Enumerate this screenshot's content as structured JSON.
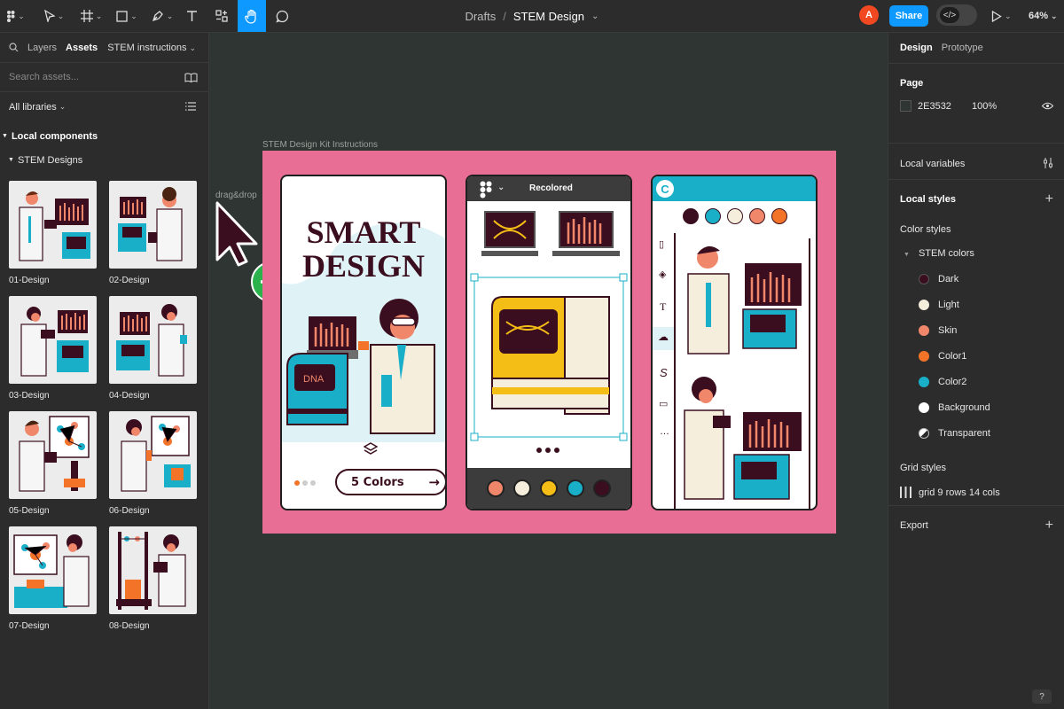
{
  "toolbar": {
    "breadcrumb_parent": "Drafts",
    "breadcrumb_sep": "/",
    "file_name": "STEM Design",
    "avatar_letter": "A",
    "share_label": "Share",
    "zoom": "64%",
    "accent": "#0D99FF"
  },
  "left_panel": {
    "tabs": [
      "Layers",
      "Assets"
    ],
    "library_dropdown": "STEM instructions",
    "search_placeholder": "Search assets...",
    "libraries": "All libraries",
    "local_components": "Local components",
    "group": "STEM Designs",
    "components": [
      "01-Design",
      "02-Design",
      "03-Design",
      "04-Design",
      "05-Design",
      "06-Design",
      "07-Design",
      "08-Design"
    ]
  },
  "canvas": {
    "frame_label": "STEM Design Kit Instructions",
    "drag_label": "drag&drop",
    "card1": {
      "title_line1": "SMART",
      "title_line2": "DESIGN",
      "button": "5 Colors",
      "arrow": "→"
    },
    "card2": {
      "header": "Recolored",
      "palette": [
        "#F0876A",
        "#F6EEDC",
        "#F5BE17",
        "#1AAFC8",
        "#3A0E1E"
      ]
    },
    "card3": {
      "logo": "C",
      "palette": [
        "#3A0E1E",
        "#1AAFC8",
        "#F6EEDC",
        "#F0876A",
        "#F37329"
      ]
    }
  },
  "right_panel": {
    "tabs": [
      "Design",
      "Prototype"
    ],
    "page_title": "Page",
    "page_color": "2E3532",
    "page_opacity": "100%",
    "local_variables": "Local variables",
    "local_styles": "Local styles",
    "color_styles": "Color styles",
    "color_group": "STEM colors",
    "colors": [
      {
        "name": "Dark",
        "hex": "#3A0E1E"
      },
      {
        "name": "Light",
        "hex": "#F6EEDC"
      },
      {
        "name": "Skin",
        "hex": "#F0876A"
      },
      {
        "name": "Color1",
        "hex": "#F37329"
      },
      {
        "name": "Color2",
        "hex": "#1AAFC8"
      },
      {
        "name": "Background",
        "hex": "#FFFFFF"
      },
      {
        "name": "Transparent",
        "hex": "transparent"
      }
    ],
    "grid_styles": "Grid styles",
    "grid": "grid 9 rows 14 cols",
    "export": "Export"
  }
}
